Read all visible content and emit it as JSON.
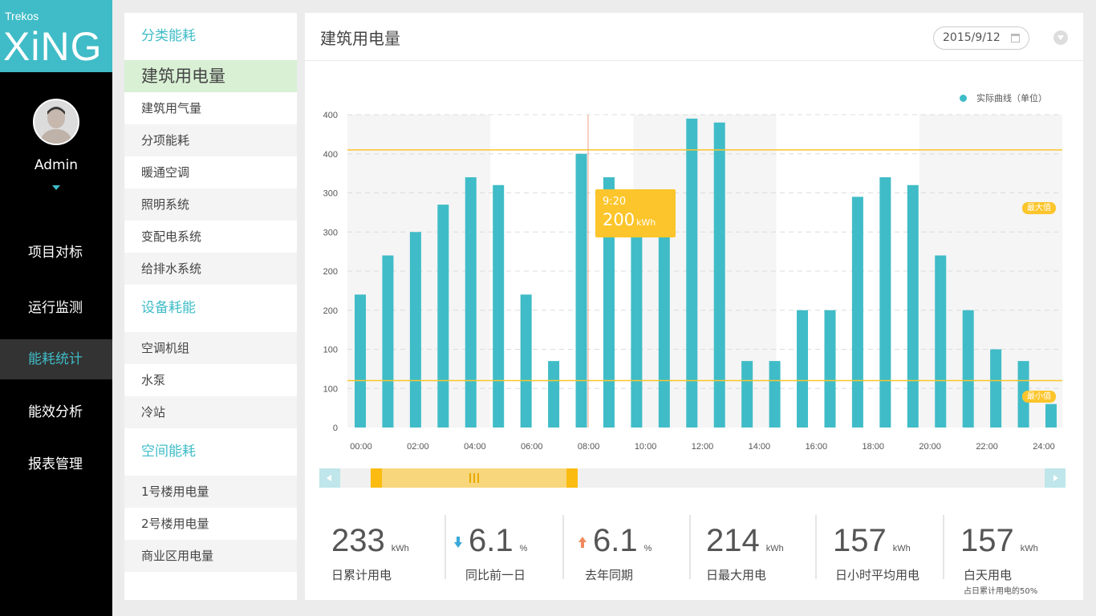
{
  "app": {
    "brand_small": "Trekos",
    "brand_big": "XiNG"
  },
  "user": {
    "name": "Admin"
  },
  "nav": {
    "items": [
      {
        "label": "项目对标"
      },
      {
        "label": "运行监测"
      },
      {
        "label": "能耗统计",
        "active": true
      },
      {
        "label": "能效分析"
      },
      {
        "label": "报表管理"
      }
    ]
  },
  "categories": {
    "groups": [
      {
        "heading": "分类能耗",
        "items": [
          "建筑用电量",
          "建筑用气量",
          "分项能耗",
          "暖通空调",
          "照明系统",
          "变配电系统",
          "给排水系统"
        ]
      },
      {
        "heading": "设备耗能",
        "items": [
          "空调机组",
          "水泵",
          "冷站"
        ]
      },
      {
        "heading": "空间能耗",
        "items": [
          "1号楼用电量",
          "2号楼用电量",
          "商业区用电量"
        ]
      }
    ],
    "active": "建筑用电量"
  },
  "main": {
    "title": "建筑用电量",
    "date": "2015/9/12",
    "legend": "实际曲线（单位）",
    "max_badge": "最大值",
    "min_badge": "最小值"
  },
  "tooltip": {
    "time": "9:20",
    "value": "200",
    "unit": "kWh"
  },
  "chart_data": {
    "type": "bar",
    "y_tick_labels": [
      "0",
      "100",
      "100",
      "200",
      "200",
      "300",
      "300",
      "400",
      "400"
    ],
    "x_tick_labels": [
      "00:00",
      "02:00",
      "04:00",
      "06:00",
      "08:00",
      "10:00",
      "12:00",
      "14:00",
      "16:00",
      "18:00",
      "20:00",
      "22:00",
      "24:00"
    ],
    "ylim": [
      0,
      400
    ],
    "values": [
      170,
      220,
      250,
      285,
      320,
      310,
      170,
      85,
      350,
      320,
      250,
      250,
      395,
      390,
      85,
      85,
      150,
      150,
      295,
      320,
      310,
      220,
      150,
      100,
      85,
      30
    ],
    "max_line": 355,
    "min_line": 60,
    "series": [
      {
        "name": "实际曲线（单位）",
        "color": "#3fbcc7"
      }
    ],
    "grid": true,
    "legend_position": "top-right"
  },
  "stats": [
    {
      "value": "233",
      "unit": "kWh",
      "label": "日累计用电"
    },
    {
      "value": "6.1",
      "unit": "%",
      "label": "同比前一日",
      "trend": "down"
    },
    {
      "value": "6.1",
      "unit": "%",
      "label": "去年同期",
      "trend": "up"
    },
    {
      "value": "214",
      "unit": "kWh",
      "label": "日最大用电"
    },
    {
      "value": "157",
      "unit": "kWh",
      "label": "日小时平均用电"
    },
    {
      "value": "157",
      "unit": "kWh",
      "label": "白天用电",
      "note": "占日累计用电的50%"
    }
  ],
  "colors": {
    "accent": "#3fbcc7",
    "highlight": "#fcc52b",
    "nav_bg": "#000000"
  }
}
